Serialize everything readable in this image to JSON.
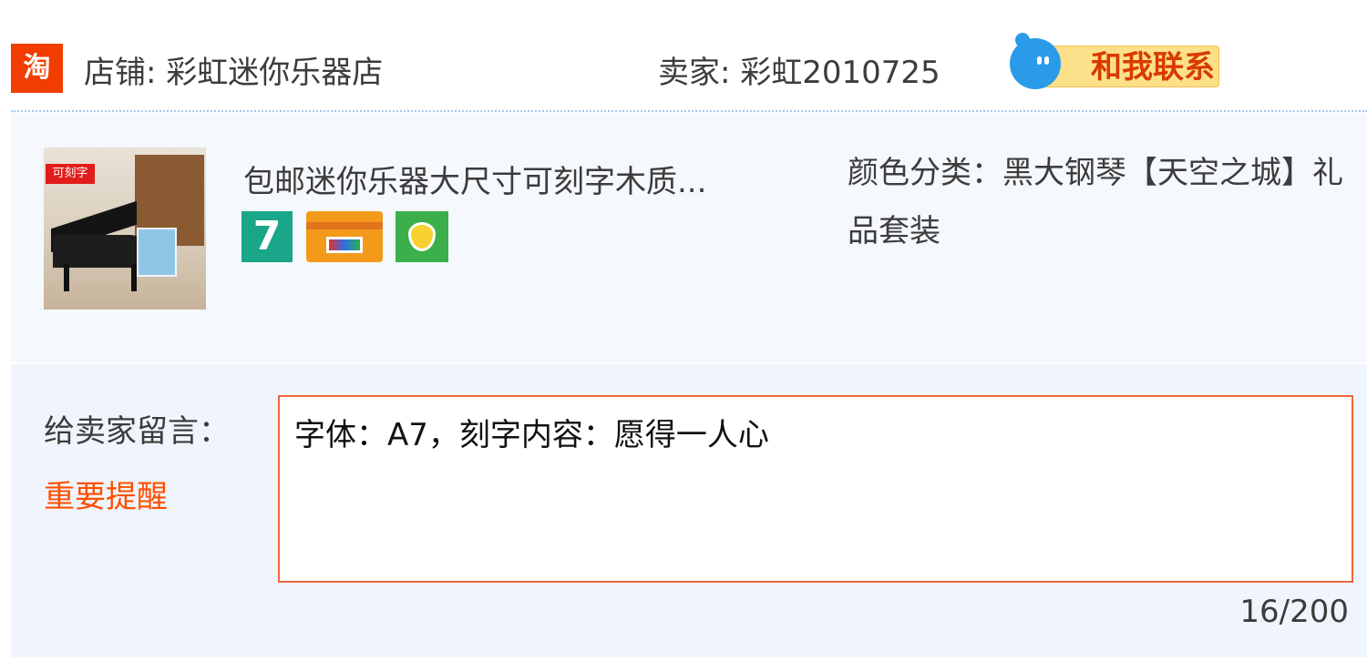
{
  "header": {
    "logo_text": "淘",
    "shop_label": "店铺: 彩虹迷你乐器店",
    "seller_label": "卖家: 彩虹2010725",
    "contact_button_label": "和我联系",
    "contact_icon": "chat-bubble-icon"
  },
  "item": {
    "thumb_tag": "可刻字",
    "title": "包邮迷你乐器大尺寸可刻字木质...",
    "badges": [
      {
        "name": "seven-day-return-icon",
        "text": "7"
      },
      {
        "name": "credit-card-payment-icon",
        "text": ""
      },
      {
        "name": "consumer-protection-shield-icon",
        "text": ""
      }
    ],
    "sku_line": "颜色分类：黑大钢琴【天空之城】礼品套装"
  },
  "message": {
    "label": "给卖家留言：",
    "reminder_label": "重要提醒",
    "input_value": "字体：A7，刻字内容：愿得一人心",
    "counter": "16/200"
  },
  "colors": {
    "taobao_orange": "#f23d00",
    "accent_orange": "#ff5000",
    "input_border": "#f0653a",
    "divider_blue": "#a8c8ee",
    "section_bg": "#f0f5fd"
  }
}
